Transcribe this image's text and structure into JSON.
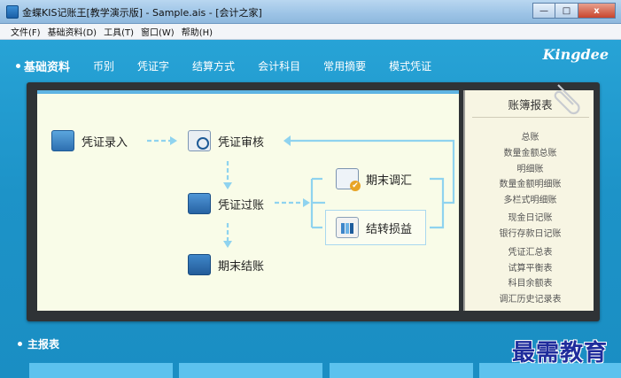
{
  "window": {
    "title": "金蝶KIS记账王[教学演示版] - Sample.ais - [会计之家]",
    "buttons": {
      "minimize": "—",
      "maximize": "□",
      "close": "x"
    }
  },
  "menu": [
    "文件(F)",
    "基础资料(D)",
    "工具(T)",
    "窗口(W)",
    "帮助(H)"
  ],
  "nav": {
    "active": "基础资料",
    "items": [
      "币别",
      "凭证字",
      "结算方式",
      "会计科目",
      "常用摘要",
      "模式凭证"
    ]
  },
  "brand": "Kingdee",
  "flow": {
    "voucher_entry": "凭证录入",
    "voucher_audit": "凭证审核",
    "voucher_post": "凭证过账",
    "period_close": "期末结账",
    "period_adjust": "期末调汇",
    "profit_transfer": "结转损益"
  },
  "reports": {
    "title": "账簿报表",
    "groups": [
      [
        "总账",
        "数量金额总账",
        "明细账",
        "数量金额明细账",
        "多栏式明细账"
      ],
      [
        "现金日记账",
        "银行存款日记账"
      ],
      [
        "凭证汇总表",
        "试算平衡表",
        "科目余额表",
        "调汇历史记录表"
      ]
    ]
  },
  "bottom": {
    "title": "主报表"
  },
  "watermark": "最需教育",
  "colors": {
    "background": "#1f96cb",
    "panel": "#f9fce8",
    "arrow": "#8fd3ef",
    "frame": "#2f3336"
  }
}
